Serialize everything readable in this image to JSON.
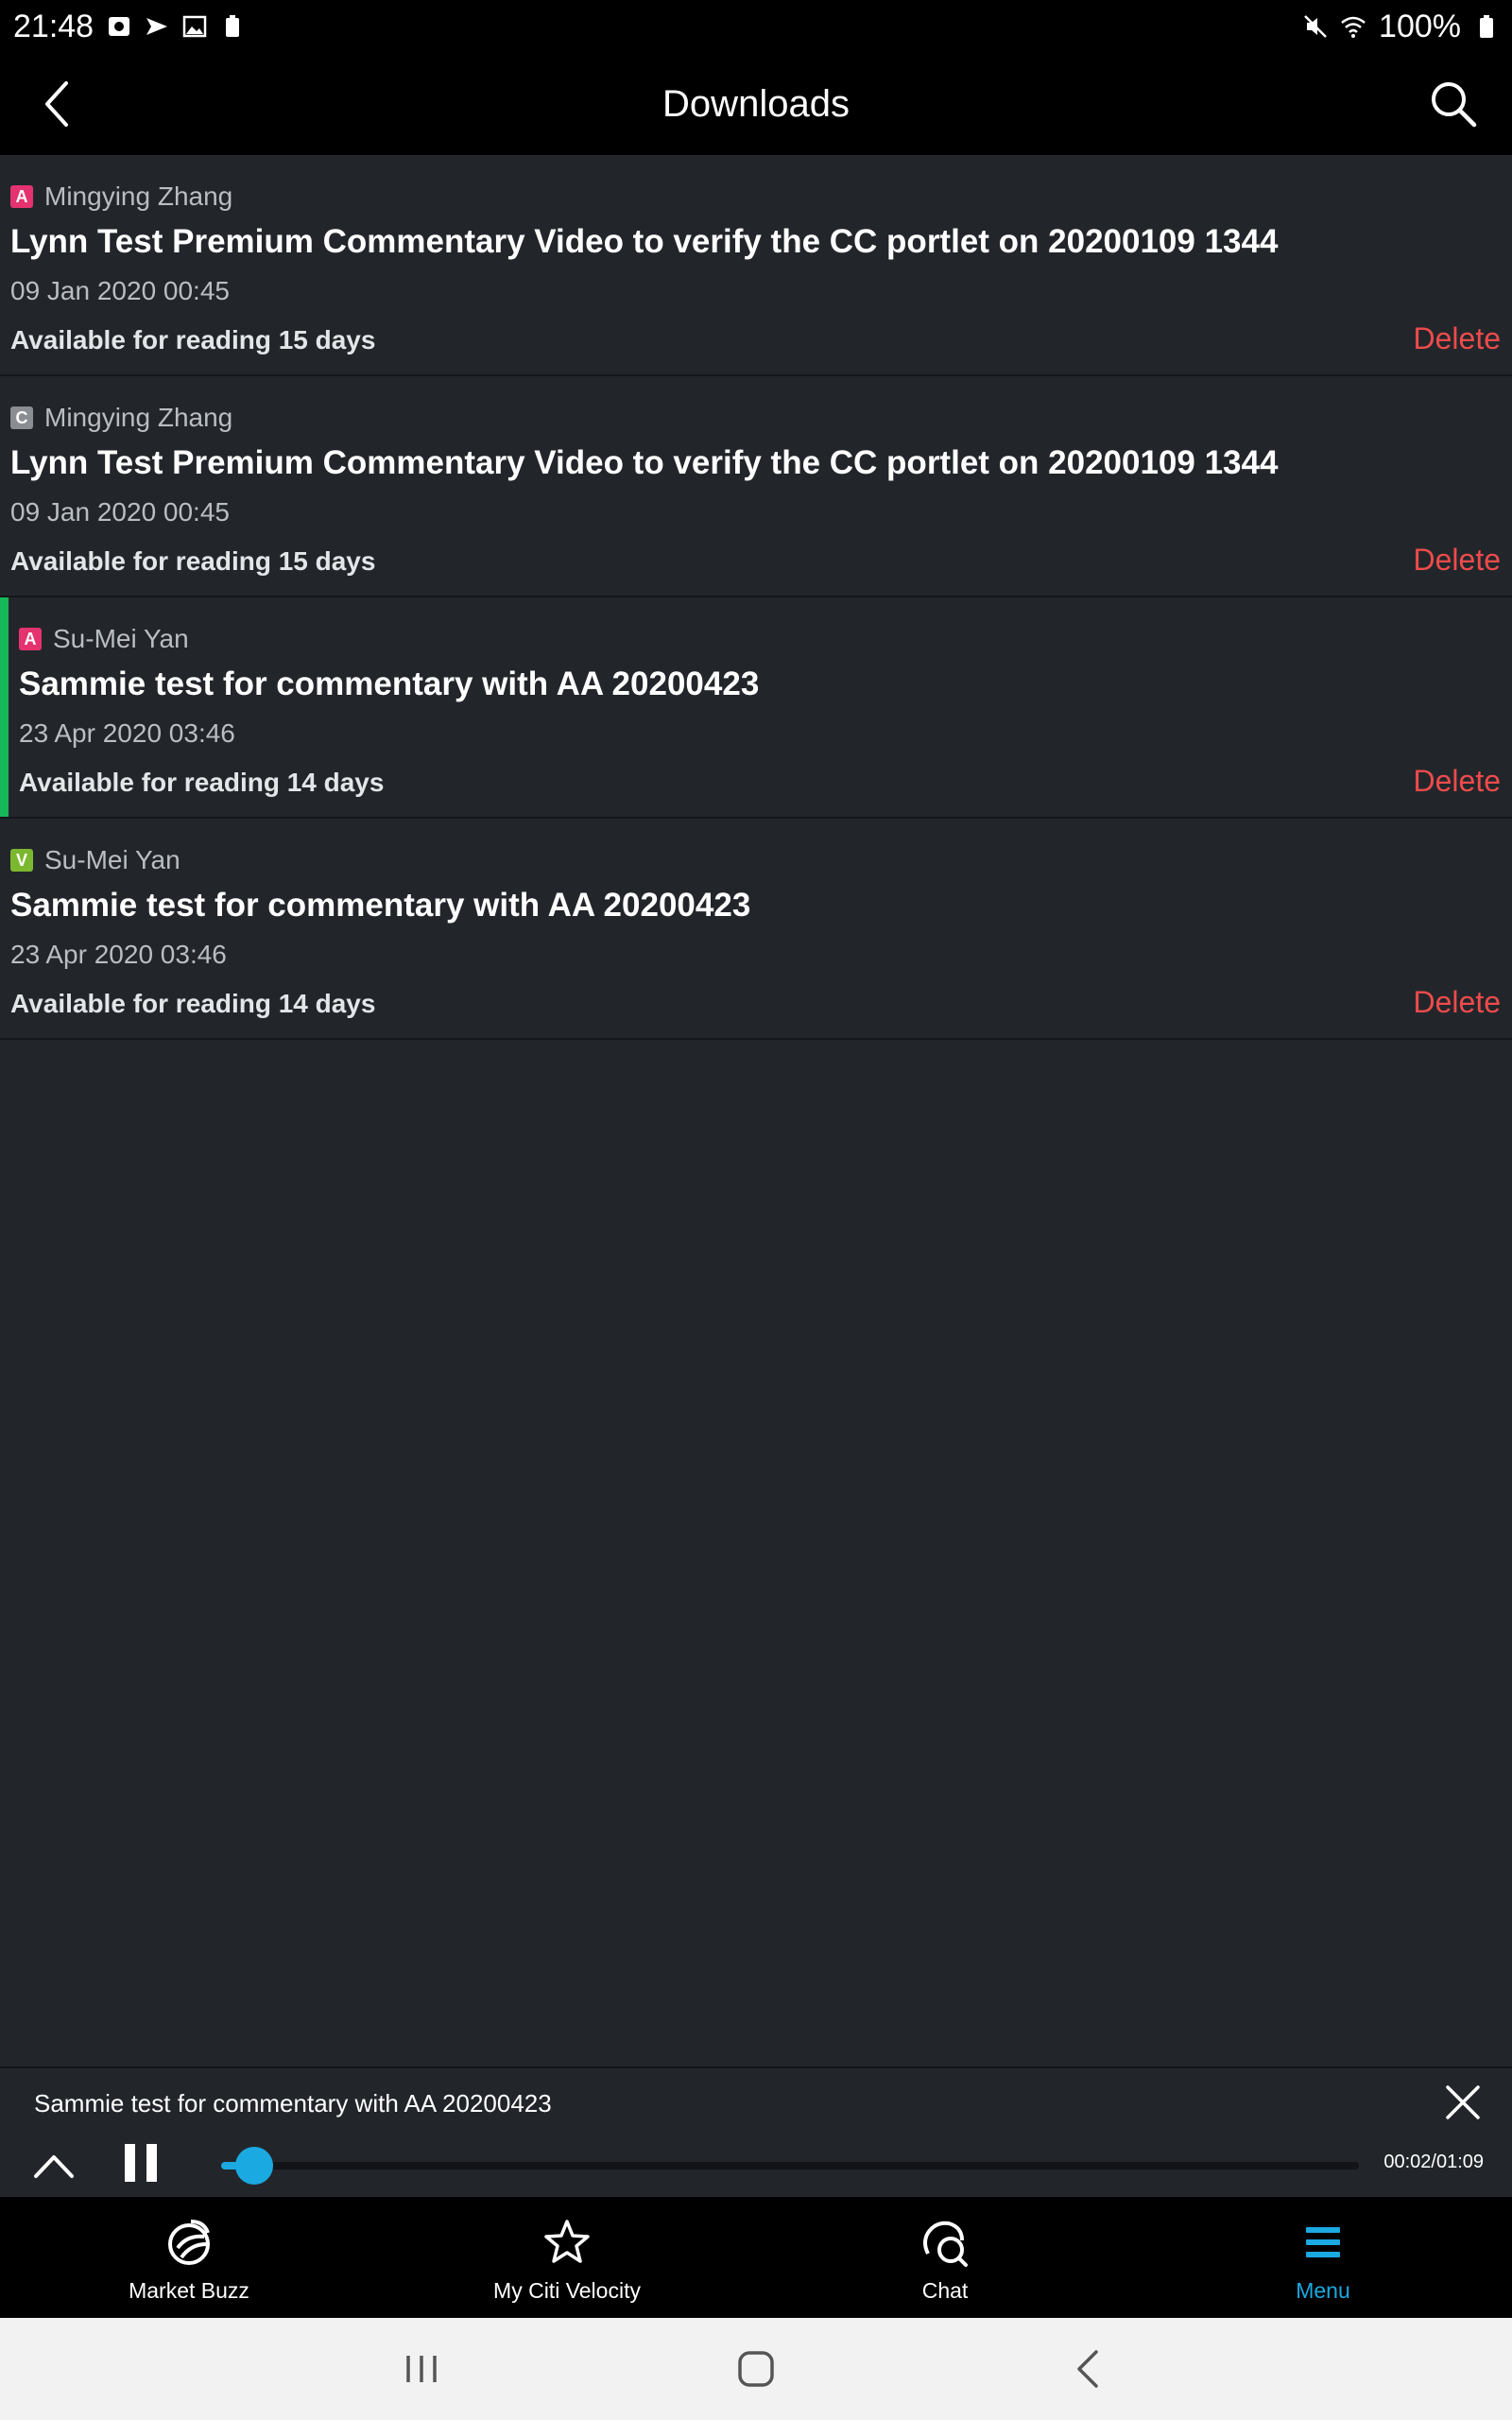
{
  "status_bar": {
    "time": "21:48",
    "battery_percent": "100%",
    "left_icons": [
      "screen-record-icon",
      "navigation-arrow-icon",
      "image-icon",
      "battery-saver-icon"
    ],
    "right_icons": [
      "mute-icon",
      "wifi-icon",
      "battery-icon"
    ]
  },
  "app_bar": {
    "title": "Downloads",
    "back_icon": "chevron-left-icon",
    "search_icon": "search-icon"
  },
  "downloads": [
    {
      "badge_letter": "A",
      "badge_color": "#e5336f",
      "author": "Mingying Zhang",
      "title": "Lynn Test Premium Commentary Video to verify the CC portlet on 20200109 1344",
      "date": "09 Jan 2020 00:45",
      "availability": "Available for reading 15 days",
      "delete_label": "Delete",
      "active": false
    },
    {
      "badge_letter": "C",
      "badge_color": "#8a8e92",
      "author": "Mingying Zhang",
      "title": "Lynn Test Premium Commentary Video to verify the CC portlet on 20200109 1344",
      "date": "09 Jan 2020 00:45",
      "availability": "Available for reading 15 days",
      "delete_label": "Delete",
      "active": false
    },
    {
      "badge_letter": "A",
      "badge_color": "#e5336f",
      "author": "Su-Mei Yan",
      "title": "Sammie test for commentary with AA 20200423",
      "date": "23 Apr 2020 03:46",
      "availability": "Available for reading 14 days",
      "delete_label": "Delete",
      "active": true
    },
    {
      "badge_letter": "V",
      "badge_color": "#7cb82f",
      "author": "Su-Mei Yan",
      "title": "Sammie test for commentary with AA 20200423",
      "date": "23 Apr 2020 03:46",
      "availability": "Available for reading 14 days",
      "delete_label": "Delete",
      "active": false
    }
  ],
  "player": {
    "title": "Sammie test for commentary with AA 20200423",
    "time": "00:02/01:09",
    "progress_fraction": 0.029,
    "accent_color": "#1ba9e1",
    "close_icon": "close-icon",
    "expand_icon": "chevron-up-icon",
    "pause_icon": "pause-icon"
  },
  "tabs": [
    {
      "label": "Market Buzz",
      "icon": "market-buzz-icon",
      "active": false
    },
    {
      "label": "My Citi Velocity",
      "icon": "star-icon",
      "active": false
    },
    {
      "label": "Chat",
      "icon": "chat-icon",
      "active": false
    },
    {
      "label": "Menu",
      "icon": "menu-icon",
      "active": true
    }
  ],
  "system_nav": [
    "recents-icon",
    "home-icon",
    "back-icon"
  ]
}
